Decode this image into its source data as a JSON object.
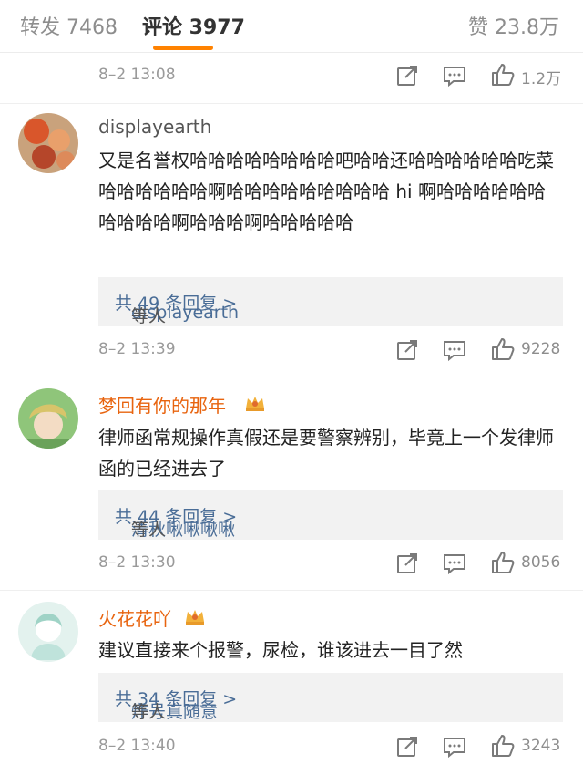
{
  "tabs": {
    "repost": "转发 7468",
    "comments": "评论 3977",
    "likes": "赞 23.8万"
  },
  "colors": {
    "accent": "#ff8200",
    "vip_name": "#e8640f",
    "link": "#4a6d97"
  },
  "top_meta": {
    "time": "8–2 13:08",
    "likes": "1.2万"
  },
  "comments": [
    {
      "user": "displayearth",
      "text": "又是名誉权哈哈哈哈哈哈哈哈吧哈哈还哈哈哈哈哈哈吃菜哈哈哈哈哈哈啊哈哈哈哈哈哈哈哈哈 hi 啊哈哈哈哈哈哈哈哈哈哈啊哈哈哈啊哈哈哈哈哈",
      "reply_who": "displayearth",
      "reply_mid": " 等人 ",
      "reply_total": "共 49 条回复 >",
      "time": "8–2 13:39",
      "likes": "9228"
    },
    {
      "user": "梦回有你的那年",
      "text": "律师函常规操作真假还是要警察辨别，毕竟上一个发律师函的已经进去了",
      "reply_who": "清秋啾啾啾啾",
      "reply_mid": "等人 ",
      "reply_total": "共 44 条回复 >",
      "time": "8–2 13:30",
      "likes": "8056"
    },
    {
      "user": "火花花吖",
      "text": "建议直接来个报警，尿检，谁该进去一目了然",
      "reply_who": "炸号真随意",
      "reply_mid": "等人 ",
      "reply_total": "共 34 条回复 >",
      "time": "8–2 13:40",
      "likes": "3243"
    }
  ],
  "icons": {
    "share": "share-icon",
    "reply": "comment-icon",
    "like": "thumbs-up-icon",
    "vip": "crown-icon"
  }
}
